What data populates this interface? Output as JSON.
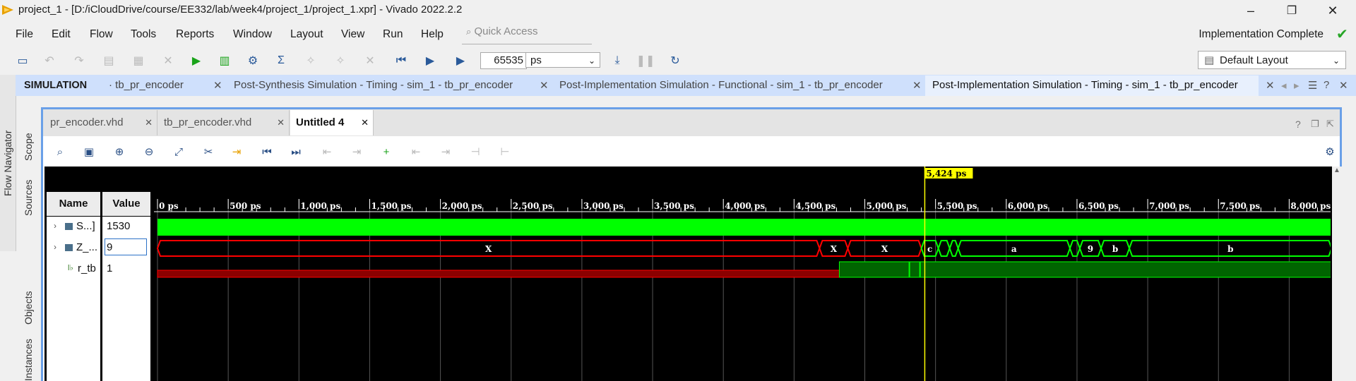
{
  "window": {
    "title": "project_1 - [D:/iCloudDrive/course/EE332/lab/week4/project_1/project_1.xpr] - Vivado 2022.2.2",
    "minimize": "–",
    "maximize": "❐",
    "close": "✕"
  },
  "menu": {
    "items": [
      "File",
      "Edit",
      "Flow",
      "Tools",
      "Reports",
      "Window",
      "Layout",
      "View",
      "Run",
      "Help"
    ],
    "quick_access_placeholder": "Quick Access",
    "status": "Implementation Complete",
    "status_color": "#27a627"
  },
  "toolbar": {
    "time_value": "65535",
    "time_unit": "ps",
    "layout": "Default Layout"
  },
  "left_strip": {
    "label": "Flow Navigator"
  },
  "simulation": {
    "title": "SIMULATION",
    "tabs": [
      {
        "label": "· tb_pr_encoder",
        "active": false
      },
      {
        "label": "Post-Synthesis Simulation - Timing - sim_1 - tb_pr_encoder",
        "active": false
      },
      {
        "label": "Post-Implementation Simulation - Functional - sim_1 - tb_pr_encoder",
        "active": false
      },
      {
        "label": "Post-Implementation Simulation - Timing - sim_1 - tb_pr_encoder",
        "active": true
      }
    ],
    "side_labels": [
      "Scope",
      "Sources",
      "Objects",
      "Instances"
    ]
  },
  "file_tabs": [
    {
      "label": "pr_encoder.vhd",
      "active": false
    },
    {
      "label": "tb_pr_encoder.vhd",
      "active": false
    },
    {
      "label": "Untitled 4",
      "active": true
    }
  ],
  "wave": {
    "name_header": "Name",
    "value_header": "Value",
    "cursor_label": "5,424 ps",
    "cursor_time": 5424,
    "time_range_ps": [
      0,
      8300
    ],
    "tick_step_ps": 500,
    "tick_labels": [
      "0 ps",
      "500 ps",
      "1,000 ps",
      "1,500 ps",
      "2,000 ps",
      "2,500 ps",
      "3,000 ps",
      "3,500 ps",
      "4,000 ps",
      "4,500 ps",
      "5,000 ps",
      "5,500 ps",
      "6,000 ps",
      "6,500 ps",
      "7,000 ps",
      "7,500 ps",
      "8,000 ps"
    ],
    "signals": [
      {
        "name": "S...]",
        "value": "1530",
        "kind": "bus-valid"
      },
      {
        "name": "Z_...",
        "value": "9",
        "kind": "bus-mixed"
      },
      {
        "name": "r_tb",
        "value": "1",
        "kind": "bit"
      }
    ],
    "z_segments": [
      {
        "start": 0,
        "end": 4680,
        "label": "X",
        "state": "x"
      },
      {
        "start": 4680,
        "end": 4880,
        "label": "X",
        "state": "x"
      },
      {
        "start": 4880,
        "end": 5400,
        "label": "X",
        "state": "x"
      },
      {
        "start": 5400,
        "end": 5520,
        "label": "c",
        "state": "valid"
      },
      {
        "start": 5520,
        "end": 5600,
        "label": "",
        "state": "valid"
      },
      {
        "start": 5600,
        "end": 5660,
        "label": "",
        "state": "valid"
      },
      {
        "start": 5660,
        "end": 6450,
        "label": "a",
        "state": "valid"
      },
      {
        "start": 6450,
        "end": 6520,
        "label": "",
        "state": "valid"
      },
      {
        "start": 6520,
        "end": 6670,
        "label": "9",
        "state": "valid"
      },
      {
        "start": 6670,
        "end": 6870,
        "label": "b",
        "state": "valid"
      },
      {
        "start": 6870,
        "end": 8300,
        "label": "b",
        "state": "valid"
      }
    ],
    "r_tb_x_until": 4820,
    "r_tb_glitches": [
      5315,
      5390
    ],
    "colors": {
      "valid": "#00ff00",
      "x": "#ff0000",
      "cursor": "#ffff00",
      "grid": "#555555"
    }
  }
}
